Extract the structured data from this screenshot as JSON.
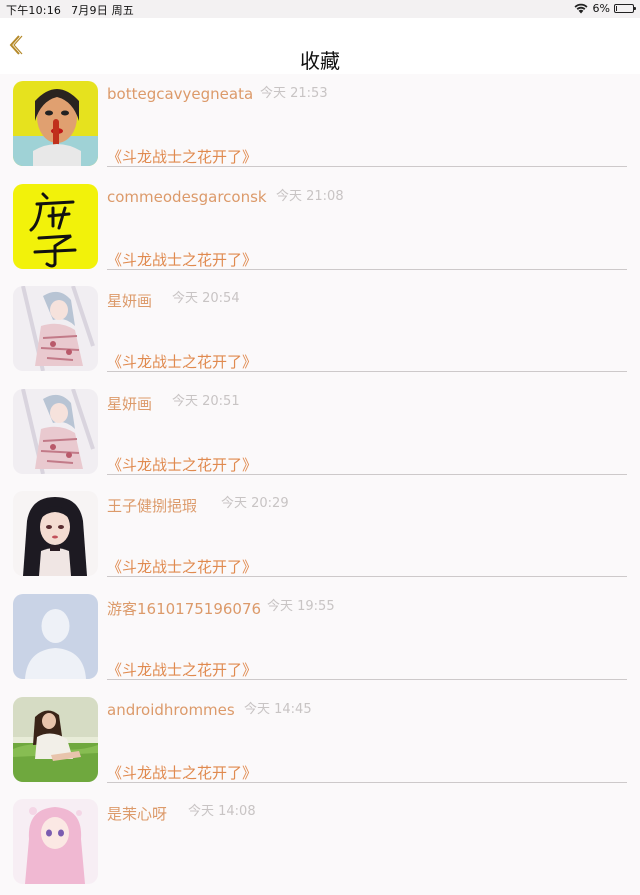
{
  "status_bar": {
    "time": "下午10:16",
    "date": "7月9日 周五",
    "battery_percent": "6%",
    "battery_level": 0.06
  },
  "nav": {
    "title": "收藏",
    "back_icon": "chevron-left-icon",
    "accent_color": "#dc9a6a"
  },
  "items": [
    {
      "username": "bottegcavyegneata",
      "time": "今天 21:53",
      "book": "《斗龙战士之花开了》",
      "avatar": "woman-yellow-background"
    },
    {
      "username": "commeodesgarconsk",
      "time": "今天 21:08",
      "book": "《斗龙战士之花开了》",
      "avatar": "calligraphy-yellow"
    },
    {
      "username": "星妍画",
      "time": "今天 20:54",
      "book": "《斗龙战士之花开了》",
      "avatar": "anime-girl-pink"
    },
    {
      "username": "星妍画",
      "time": "今天 20:51",
      "book": "《斗龙战士之花开了》",
      "avatar": "anime-girl-pink"
    },
    {
      "username": "王子健捌挹瑕",
      "time": "今天 20:29",
      "book": "《斗龙战士之花开了》",
      "avatar": "anime-girl-dark-hair"
    },
    {
      "username": "游客1610175196076",
      "time": "今天 19:55",
      "book": "《斗龙战士之花开了》",
      "avatar": "default-user"
    },
    {
      "username": "androidhrommes",
      "time": "今天 14:45",
      "book": "《斗龙战士之花开了》",
      "avatar": "girl-on-grass"
    },
    {
      "username": "是茉心呀",
      "time": "今天 14:08",
      "book": "",
      "avatar": "anime-girl-pink-hair"
    }
  ]
}
